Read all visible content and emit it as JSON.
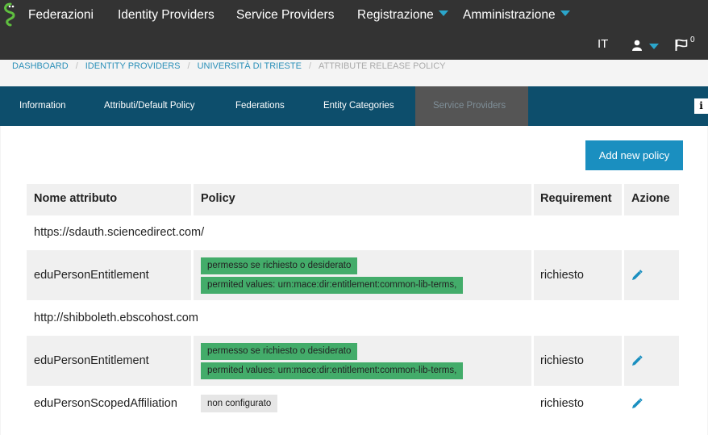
{
  "nav": {
    "logo_icon": "gecko-logo-icon",
    "items": [
      {
        "label": "Federazioni",
        "dropdown": false
      },
      {
        "label": "Identity Providers",
        "dropdown": false
      },
      {
        "label": "Service Providers",
        "dropdown": false
      },
      {
        "label": "Registrazione",
        "dropdown": true
      },
      {
        "label": "Amministrazione",
        "dropdown": true
      }
    ],
    "language": "IT",
    "user_icon": "user-icon",
    "flag_icon": "flag-icon",
    "notification_count": "0"
  },
  "breadcrumb": [
    {
      "label": "DASHBOARD"
    },
    {
      "label": "IDENTITY PROVIDERS"
    },
    {
      "label": "UNIVERSITÀ DI TRIESTE"
    },
    {
      "label": "ATTRIBUTE RELEASE POLICY"
    }
  ],
  "tabs": [
    {
      "label": "Information"
    },
    {
      "label": "Attributi/Default Policy"
    },
    {
      "label": "Federations"
    },
    {
      "label": "Entity Categories"
    },
    {
      "label": "Service Providers",
      "active": true
    }
  ],
  "info_icon": "info-icon",
  "add_policy_label": "Add new policy",
  "colors": {
    "accent": "#2ba6cb",
    "tab_bar": "#0d4e6c",
    "button": "#1a8fc0",
    "green_tag": "#43ac6a"
  },
  "table": {
    "headers": {
      "name": "Nome attributo",
      "policy": "Policy",
      "requirement": "Requirement",
      "action": "Azione"
    },
    "groups": [
      {
        "sp": "https://sdauth.sciencedirect.com/",
        "rows": [
          {
            "name": "eduPersonEntitlement",
            "policy": [
              "permesso se richiesto o desiderato",
              "permited values: urn:mace:dir:entitlement:common-lib-terms,"
            ],
            "requirement": "richiesto",
            "action_icon": "edit-pencil-icon"
          }
        ]
      },
      {
        "sp": "http://shibboleth.ebscohost.com",
        "rows": [
          {
            "name": "eduPersonEntitlement",
            "policy": [
              "permesso se richiesto o desiderato",
              "permited values: urn:mace:dir:entitlement:common-lib-terms,"
            ],
            "requirement": "richiesto",
            "action_icon": "edit-pencil-icon"
          },
          {
            "name": "eduPersonScopedAffiliation",
            "policy_grey": "non configurato",
            "requirement": "richiesto",
            "action_icon": "edit-pencil-icon"
          }
        ]
      }
    ]
  }
}
